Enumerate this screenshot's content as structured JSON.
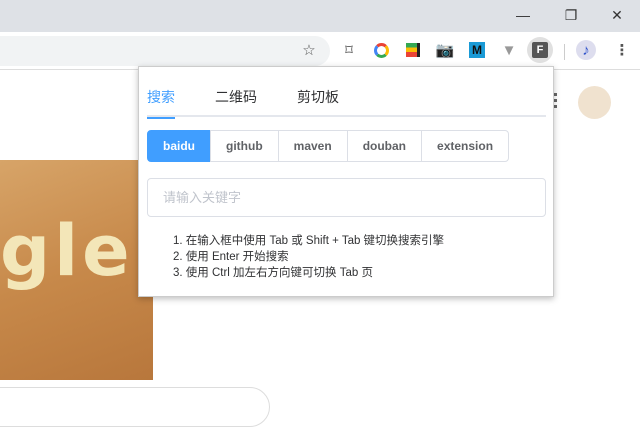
{
  "window": {
    "minimize": "—",
    "restore": "❐",
    "close": "✕"
  },
  "toolbar": {
    "icons": [
      "star-icon",
      "bookmark-icon",
      "chrome-ring-extension-icon",
      "stack-extension-icon",
      "camera-extension-icon",
      "m-extension-icon",
      "v-extension-icon",
      "f-extension-icon",
      "music-profile-icon",
      "menu-icon"
    ],
    "m_label": "M",
    "f_label": "F"
  },
  "popup": {
    "tabs": [
      {
        "label": "搜索",
        "active": true
      },
      {
        "label": "二维码"
      },
      {
        "label": "剪切板"
      }
    ],
    "engines": [
      {
        "label": "baidu",
        "active": true
      },
      {
        "label": "github"
      },
      {
        "label": "maven"
      },
      {
        "label": "douban"
      },
      {
        "label": "extension"
      }
    ],
    "search_placeholder": "请输入关键字",
    "tips": [
      "1. 在输入框中使用 Tab 或 Shift + Tab 键切换搜索引擎",
      "2. 使用 Enter 开始搜索",
      "3. 使用 Ctrl 加左右方向键可切换 Tab 页"
    ]
  },
  "page": {
    "doodle_text": "gle"
  },
  "colors": {
    "accent": "#409eff",
    "titlebar": "#dee1e6"
  }
}
